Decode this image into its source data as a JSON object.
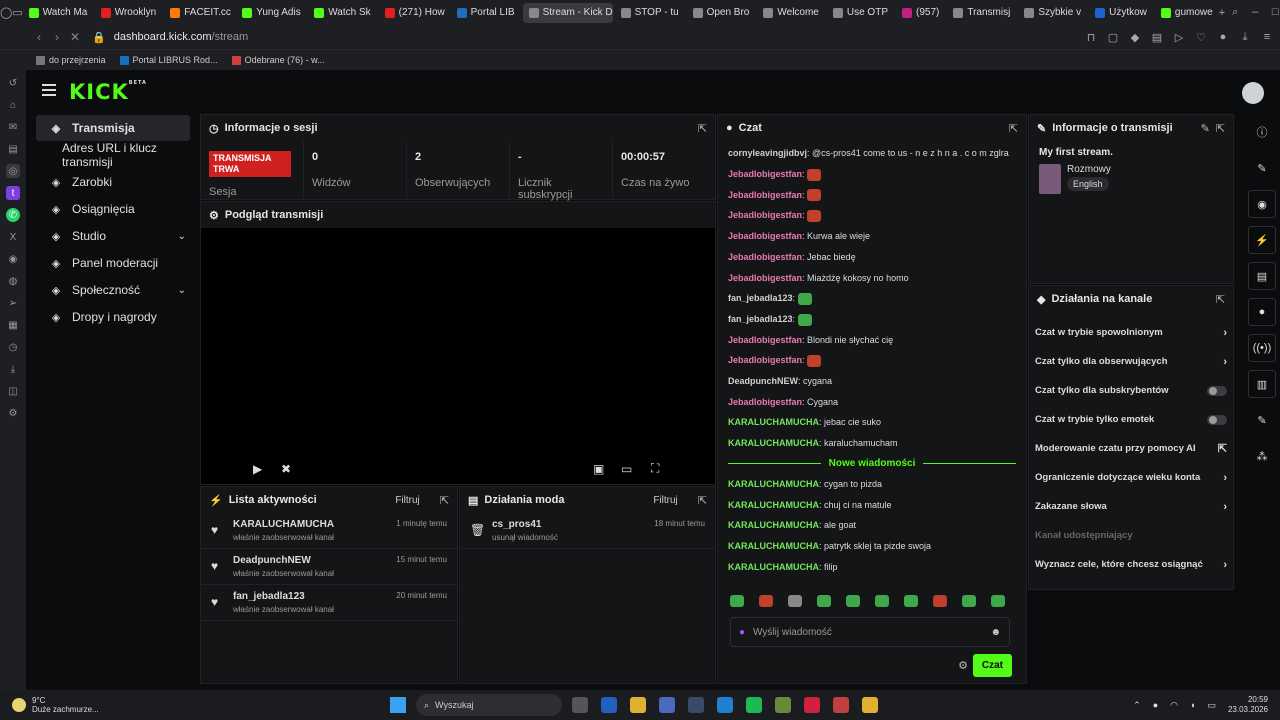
{
  "browser": {
    "tabs": [
      {
        "label": "Watch Ma",
        "color": "#53fc18"
      },
      {
        "label": "Wrooklyn",
        "color": "#e02020"
      },
      {
        "label": "FACEIT.cc",
        "color": "#ff7a00"
      },
      {
        "label": "Yung Adis",
        "color": "#53fc18"
      },
      {
        "label": "Watch Sk",
        "color": "#53fc18"
      },
      {
        "label": "(271) How",
        "color": "#e02020"
      },
      {
        "label": "Portal LIB",
        "color": "#1c6fb8"
      },
      {
        "label": "Stream - Kick Das",
        "color": "#888888",
        "active": true
      },
      {
        "label": "STOP - tu",
        "color": "#888888"
      },
      {
        "label": "Open Bro",
        "color": "#888888"
      },
      {
        "label": "Welcome",
        "color": "#888888"
      },
      {
        "label": "Use OTP",
        "color": "#888888"
      },
      {
        "label": "(957)",
        "color": "#c02080"
      },
      {
        "label": "Transmisj",
        "color": "#888888"
      },
      {
        "label": "Szybkie v",
        "color": "#888888"
      },
      {
        "label": "Użytkow",
        "color": "#2060d0"
      },
      {
        "label": "gumowe",
        "color": "#53fc18"
      }
    ],
    "url_domain": "dashboard.kick.com",
    "url_path": "/stream",
    "bookmarks": [
      "do przejrzenia",
      "Portal LIBRUS Rod...",
      "Odebrane (76) - w..."
    ]
  },
  "sidebar": {
    "items": [
      {
        "label": "Transmisja",
        "icon": "broadcast-icon",
        "active": true
      },
      {
        "label": "Adres URL i klucz transmisji",
        "sub": true
      },
      {
        "label": "Zarobki",
        "icon": "wallet-icon"
      },
      {
        "label": "Osiągnięcia",
        "icon": "trophy-icon"
      },
      {
        "label": "Studio",
        "icon": "studio-icon",
        "chevron": true
      },
      {
        "label": "Panel moderacji",
        "icon": "wrench-icon"
      },
      {
        "label": "Społeczność",
        "icon": "community-icon",
        "chevron": true
      },
      {
        "label": "Dropy i nagrody",
        "icon": "gift-icon"
      }
    ]
  },
  "session": {
    "title": "Informacje o sesji",
    "live_badge": "TRANSMISJA TRWA",
    "live_sub": "Sesja",
    "stats": [
      {
        "value": "0",
        "label": "Widzów"
      },
      {
        "value": "2",
        "label": "Obserwujących"
      },
      {
        "value": "-",
        "label": "Licznik subskrypcji"
      },
      {
        "value": "00:00:57",
        "label": "Czas na żywo"
      }
    ]
  },
  "preview": {
    "title": "Podgląd transmisji"
  },
  "activity": {
    "title": "Lista aktywności",
    "filter": "Filtruj",
    "rows": [
      {
        "user": "KARALUCHAMUCHA",
        "action": "właśnie zaobserwował kanał",
        "time": "1 minutę temu"
      },
      {
        "user": "DeadpunchNEW",
        "action": "właśnie zaobserwował kanał",
        "time": "15 minut temu"
      },
      {
        "user": "fan_jebadla123",
        "action": "właśnie zaobserwował kanał",
        "time": "20 minut temu"
      }
    ]
  },
  "modactions": {
    "title": "Działania moda",
    "filter": "Filtruj",
    "rows": [
      {
        "user": "cs_pros41",
        "action": "usunął wiadomość",
        "time": "18 minut temu"
      }
    ]
  },
  "chat": {
    "title": "Czat",
    "first_user": "cornyleavingjidbvj",
    "first_text": "@cs-pros41 come to us - n e z h n a . c o m zglra",
    "messages": [
      {
        "user": "Jebadlobigestfan",
        "text": "",
        "color": "pink",
        "emote": "red"
      },
      {
        "user": "Jebadlobigestfan",
        "text": "",
        "color": "pink",
        "emote": "red"
      },
      {
        "user": "Jebadlobigestfan",
        "text": "",
        "color": "pink",
        "emote": "red"
      },
      {
        "user": "Jebadlobigestfan",
        "text": "Kurwa ale wieje",
        "color": "pink"
      },
      {
        "user": "Jebadlobigestfan",
        "text": "Jebac biedę",
        "color": "pink"
      },
      {
        "user": "Jebadlobigestfan",
        "text": "Miażdżę kokosy no homo",
        "color": "pink"
      },
      {
        "user": "fan_jebadla123",
        "text": "",
        "color": "grey",
        "emote": "green"
      },
      {
        "user": "fan_jebadla123",
        "text": "",
        "color": "grey",
        "emote": "green"
      },
      {
        "user": "Jebadlobigestfan",
        "text": "Blondi nie słychać cię",
        "color": "pink"
      },
      {
        "user": "Jebadlobigestfan",
        "text": "",
        "color": "pink",
        "emote": "red"
      },
      {
        "user": "DeadpunchNEW",
        "text": "cygana",
        "color": "grey"
      },
      {
        "user": "Jebadlobigestfan",
        "text": "Cygana",
        "color": "pink"
      },
      {
        "user": "KARALUCHAMUCHA",
        "text": "jebac cie suko",
        "color": "green"
      },
      {
        "user": "KARALUCHAMUCHA",
        "text": "karaluchamucham",
        "color": "green"
      }
    ],
    "new_label": "Nowe wiadomości",
    "new_messages": [
      {
        "user": "KARALUCHAMUCHA",
        "text": "cygan to pizda",
        "color": "green"
      },
      {
        "user": "KARALUCHAMUCHA",
        "text": "chuj ci na matule",
        "color": "green"
      },
      {
        "user": "KARALUCHAMUCHA",
        "text": "ale goat",
        "color": "green"
      },
      {
        "user": "KARALUCHAMUCHA",
        "text": "patrytk sklej ta pizde swoja",
        "color": "green"
      },
      {
        "user": "KARALUCHAMUCHA",
        "text": "filip",
        "color": "green"
      }
    ],
    "input_placeholder": "Wyślij wiadomość",
    "send_label": "Czat"
  },
  "stream_info": {
    "title": "Informacje o transmisji",
    "stream_title": "My first stream.",
    "category": "Rozmowy",
    "language": "English"
  },
  "channel_actions": {
    "title": "Działania na kanale",
    "rows": [
      {
        "label": "Czat w trybie spowolnionym",
        "control": "arrow"
      },
      {
        "label": "Czat tylko dla obserwujących",
        "control": "arrow"
      },
      {
        "label": "Czat tylko dla subskrybentów",
        "control": "toggle"
      },
      {
        "label": "Czat w trybie tylko emotek",
        "control": "toggle"
      },
      {
        "label": "Moderowanie czatu przy pomocy AI",
        "control": "external"
      },
      {
        "label": "Ograniczenie dotyczące wieku konta",
        "control": "arrow"
      },
      {
        "label": "Zakazane słowa",
        "control": "arrow"
      },
      {
        "label": "Kanał udostępniający",
        "control": "none",
        "dim": true
      },
      {
        "label": "Wyznacz cele, które chcesz osiągnąć",
        "control": "arrow"
      }
    ]
  },
  "taskbar": {
    "temp": "9°C",
    "weather": "Duże zachmurze...",
    "search": "Wyszukaj",
    "time": "20:59",
    "date": "23.03.2026"
  },
  "colors": {
    "accent": "#53fc18",
    "live": "#d02020",
    "pink_user": "#e97ab0",
    "green_user": "#72e85a"
  }
}
